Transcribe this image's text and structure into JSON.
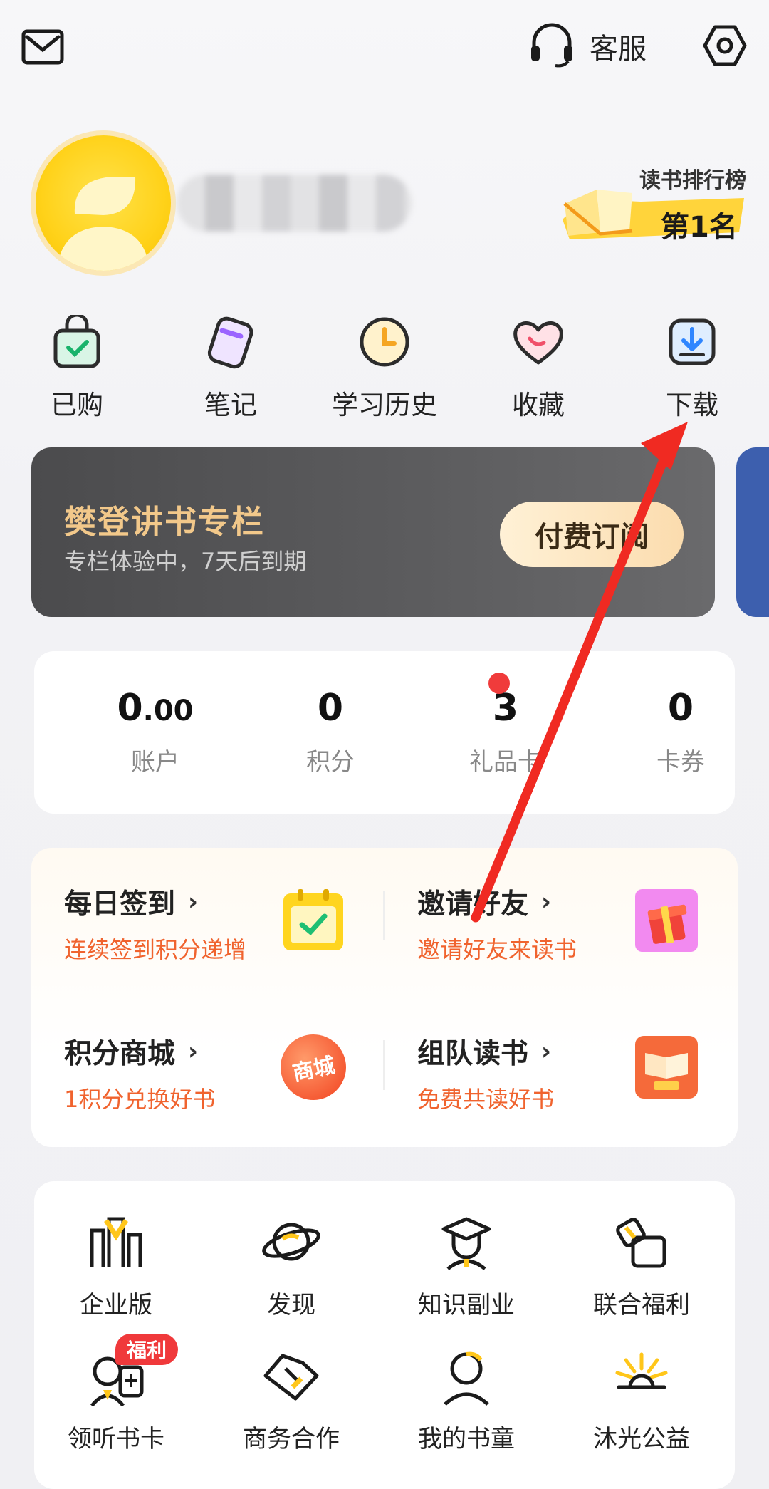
{
  "topbar": {
    "mail_icon": "mail-icon",
    "service_label": "客服",
    "settings_icon": "gear-icon"
  },
  "profile": {
    "rank_title": "读书排行榜",
    "rank_value": "第1名"
  },
  "quick_nav": [
    {
      "label": "已购",
      "icon": "shopping-bag-icon"
    },
    {
      "label": "笔记",
      "icon": "note-icon"
    },
    {
      "label": "学习历史",
      "icon": "clock-icon"
    },
    {
      "label": "收藏",
      "icon": "heart-icon"
    },
    {
      "label": "下载",
      "icon": "download-icon"
    }
  ],
  "column": {
    "title": "樊登讲书专栏",
    "subtitle": "专栏体验中，7天后到期",
    "button": "付费订阅"
  },
  "stats": [
    {
      "value_int": "0",
      "value_dec": ".00",
      "label": "账户"
    },
    {
      "value_int": "0",
      "value_dec": "",
      "label": "积分"
    },
    {
      "value_int": "3",
      "value_dec": "",
      "label": "礼品卡"
    },
    {
      "value_int": "0",
      "value_dec": "",
      "label": "卡券"
    }
  ],
  "tasks": [
    {
      "title": "每日签到",
      "sub": "连续签到积分递增",
      "icon": "calendar-check-icon"
    },
    {
      "title": "邀请好友",
      "sub": "邀请好友来读书",
      "icon": "gift-box-icon"
    },
    {
      "title": "积分商城",
      "sub": "1积分兑换好书",
      "icon": "mall-badge-icon",
      "icon_text": "商城"
    },
    {
      "title": "组队读书",
      "sub": "免费共读好书",
      "icon": "team-book-icon"
    }
  ],
  "services": [
    {
      "label": "企业版",
      "icon": "enterprise-icon"
    },
    {
      "label": "发现",
      "icon": "planet-icon"
    },
    {
      "label": "知识副业",
      "icon": "graduate-icon"
    },
    {
      "label": "联合福利",
      "icon": "coupon-icon"
    },
    {
      "label": "领听书卡",
      "icon": "listen-card-icon",
      "badge": "福利"
    },
    {
      "label": "商务合作",
      "icon": "handshake-icon"
    },
    {
      "label": "我的书童",
      "icon": "student-icon"
    },
    {
      "label": "沐光公益",
      "icon": "sunshine-icon"
    }
  ],
  "colors": {
    "accent_orange": "#f0632e",
    "gold": "#f2c88a",
    "yellow": "#ffd21a",
    "annotation_red": "#f02a22"
  }
}
